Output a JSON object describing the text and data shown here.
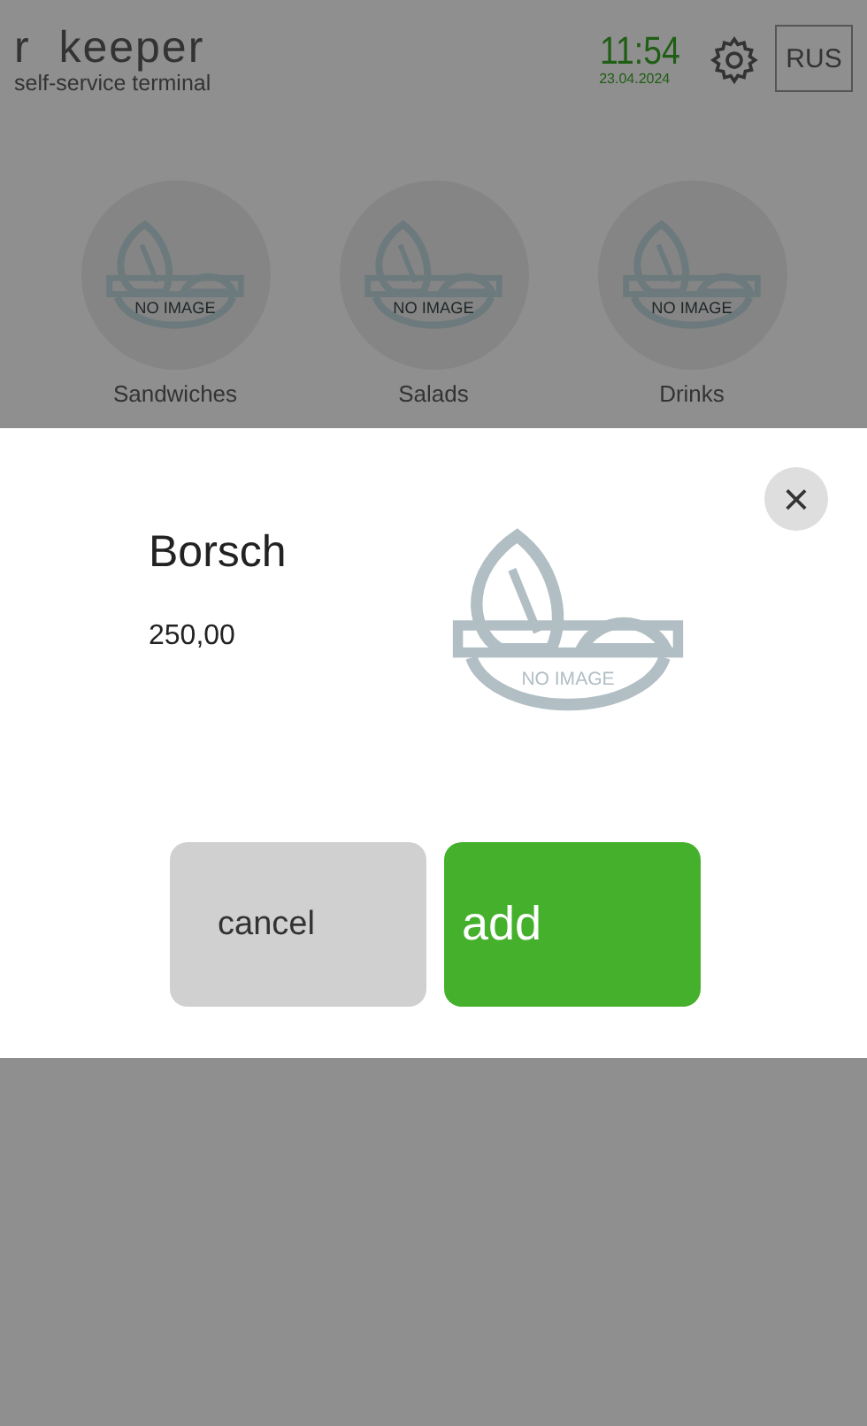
{
  "header": {
    "logo": "r  keeper",
    "subtitle": "self-service terminal",
    "time": "11:54",
    "date": "23.04.2024",
    "language": "RUS"
  },
  "categories": [
    {
      "label": "Sandwiches",
      "image_label": "NO IMAGE"
    },
    {
      "label": "Salads",
      "image_label": "NO IMAGE"
    },
    {
      "label": "Drinks",
      "image_label": "NO IMAGE"
    }
  ],
  "dialog": {
    "close": "×",
    "name": "Borsch",
    "price": "250,00",
    "image_label": "NO IMAGE",
    "buttons": [
      {
        "label": "cancel",
        "kind": "secondary"
      },
      {
        "label": "add",
        "kind": "primary"
      }
    ]
  }
}
